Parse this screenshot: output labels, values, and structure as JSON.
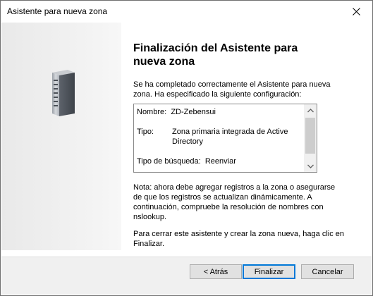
{
  "window": {
    "title": "Asistente para nueva zona",
    "close_icon": "close-icon"
  },
  "main": {
    "heading": "Finalización del Asistente para nueva zona",
    "intro": "Se ha completado correctamente el Asistente para nueva zona. Ha especificado la siguiente configuración:",
    "summary": {
      "name_label": "Nombre:",
      "name_value": "ZD-Zebensui",
      "type_label": "Tipo:",
      "type_value": "Zona primaria integrada de Active Directory",
      "lookup_label": "Tipo de búsqueda:",
      "lookup_value": "Reenviar"
    },
    "note": "Nota: ahora debe agregar registros a la zona o asegurarse de que los registros se actualizan dinámicamente. A continuación, compruebe la resolución de nombres con nslookup.",
    "closing": "Para cerrar este asistente y crear la zona nueva, haga clic en Finalizar."
  },
  "buttons": {
    "back": "< Atrás",
    "finish": "Finalizar",
    "cancel": "Cancelar"
  },
  "colors": {
    "accent": "#0078d7",
    "footer": "#f0f0f0"
  }
}
